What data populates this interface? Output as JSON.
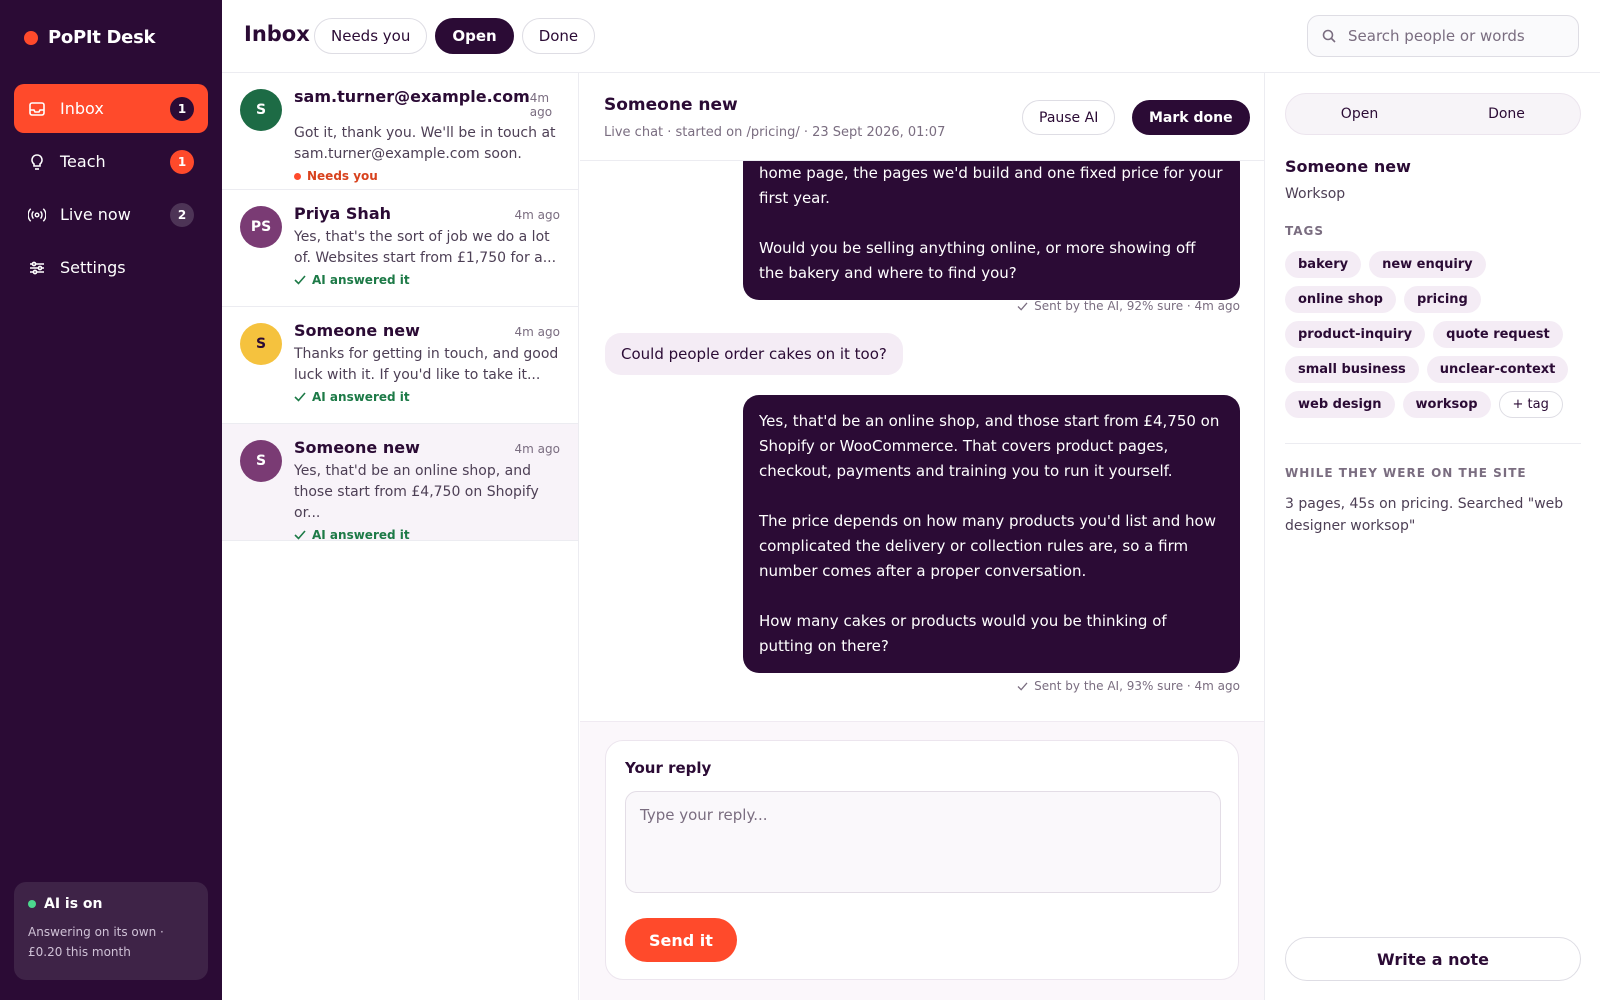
{
  "app": {
    "name": "PoPIt Desk"
  },
  "sidebar": {
    "items": [
      {
        "label": "Inbox",
        "badge": "1",
        "icon": "inbox-icon"
      },
      {
        "label": "Teach",
        "badge": "1",
        "icon": "lightbulb-icon"
      },
      {
        "label": "Live now",
        "badge": "2",
        "icon": "broadcast-icon"
      },
      {
        "label": "Settings",
        "icon": "sliders-icon"
      }
    ],
    "ai_status": {
      "title": "AI is on",
      "description": "Answering on its own · £0.20 this month"
    }
  },
  "header": {
    "title": "Inbox",
    "tabs": [
      {
        "label": "Needs you"
      },
      {
        "label": "Open"
      },
      {
        "label": "Done"
      }
    ],
    "search_placeholder": "Search people or words"
  },
  "conversations": [
    {
      "initials": "S",
      "avatar_color": "#1d6b45",
      "name": "sam.turner@example.com",
      "time": "4m ago",
      "preview": "Got it, thank you. We'll be in touch at sam.turner@example.com soon.",
      "status": "Needs you"
    },
    {
      "initials": "PS",
      "avatar_color": "#7a3b74",
      "name": "Priya Shah",
      "time": "4m ago",
      "preview": "Yes, that's the sort of job we do a lot of. Websites start from £1,750 for a...",
      "status": "AI answered it"
    },
    {
      "initials": "S",
      "avatar_color": "#f5c23e",
      "name": "Someone new",
      "time": "4m ago",
      "preview": "Thanks for getting in touch, and good luck with it. If you'd like to take it...",
      "status": "AI answered it"
    },
    {
      "initials": "S",
      "avatar_color": "#7a3b74",
      "name": "Someone new",
      "time": "4m ago",
      "preview": "Yes, that'd be an online shop, and those start from £4,750 on Shopify or...",
      "status": "AI answered it"
    }
  ],
  "chat": {
    "title": "Someone new",
    "subtitle": "Live chat · started on /pricing/ · 23 Sept 2026, 01:07",
    "pause_label": "Pause AI",
    "done_label": "Mark done",
    "messages": [
      {
        "p1": "home page, the pages we'd build and one fixed price for your first year.",
        "p2": "Would you be selling anything online, or more showing off the bakery and where to find you?",
        "meta": "Sent by the AI, 92% sure · 4m ago"
      },
      {
        "text": "Could people order cakes on it too?"
      },
      {
        "p1": "Yes, that'd be an online shop, and those start from £4,750 on Shopify or WooCommerce. That covers product pages, checkout, payments and training you to run it yourself.",
        "p2": "The price depends on how many products you'd list and how complicated the delivery or collection rules are, so a firm number comes after a proper conversation.",
        "p3": "How many cakes or products would you be thinking of putting on there?",
        "meta": "Sent by the AI, 93% sure · 4m ago"
      }
    ],
    "composer": {
      "label": "Your reply",
      "placeholder": "Type your reply...",
      "send_label": "Send it"
    }
  },
  "details": {
    "segments": [
      {
        "label": "Open"
      },
      {
        "label": "Done"
      }
    ],
    "name": "Someone new",
    "company": "Worksop",
    "tags_title": "TAGS",
    "tags": [
      "bakery",
      "new enquiry",
      "online shop",
      "pricing",
      "product-inquiry",
      "quote request",
      "small business",
      "unclear-context",
      "web design",
      "worksop"
    ],
    "add_tag_label": "+ tag",
    "site_title": "WHILE THEY WERE ON THE SITE",
    "site_text": "3 pages, 45s on pricing. Searched \"web designer worksop\"",
    "note_label": "Write a note"
  }
}
